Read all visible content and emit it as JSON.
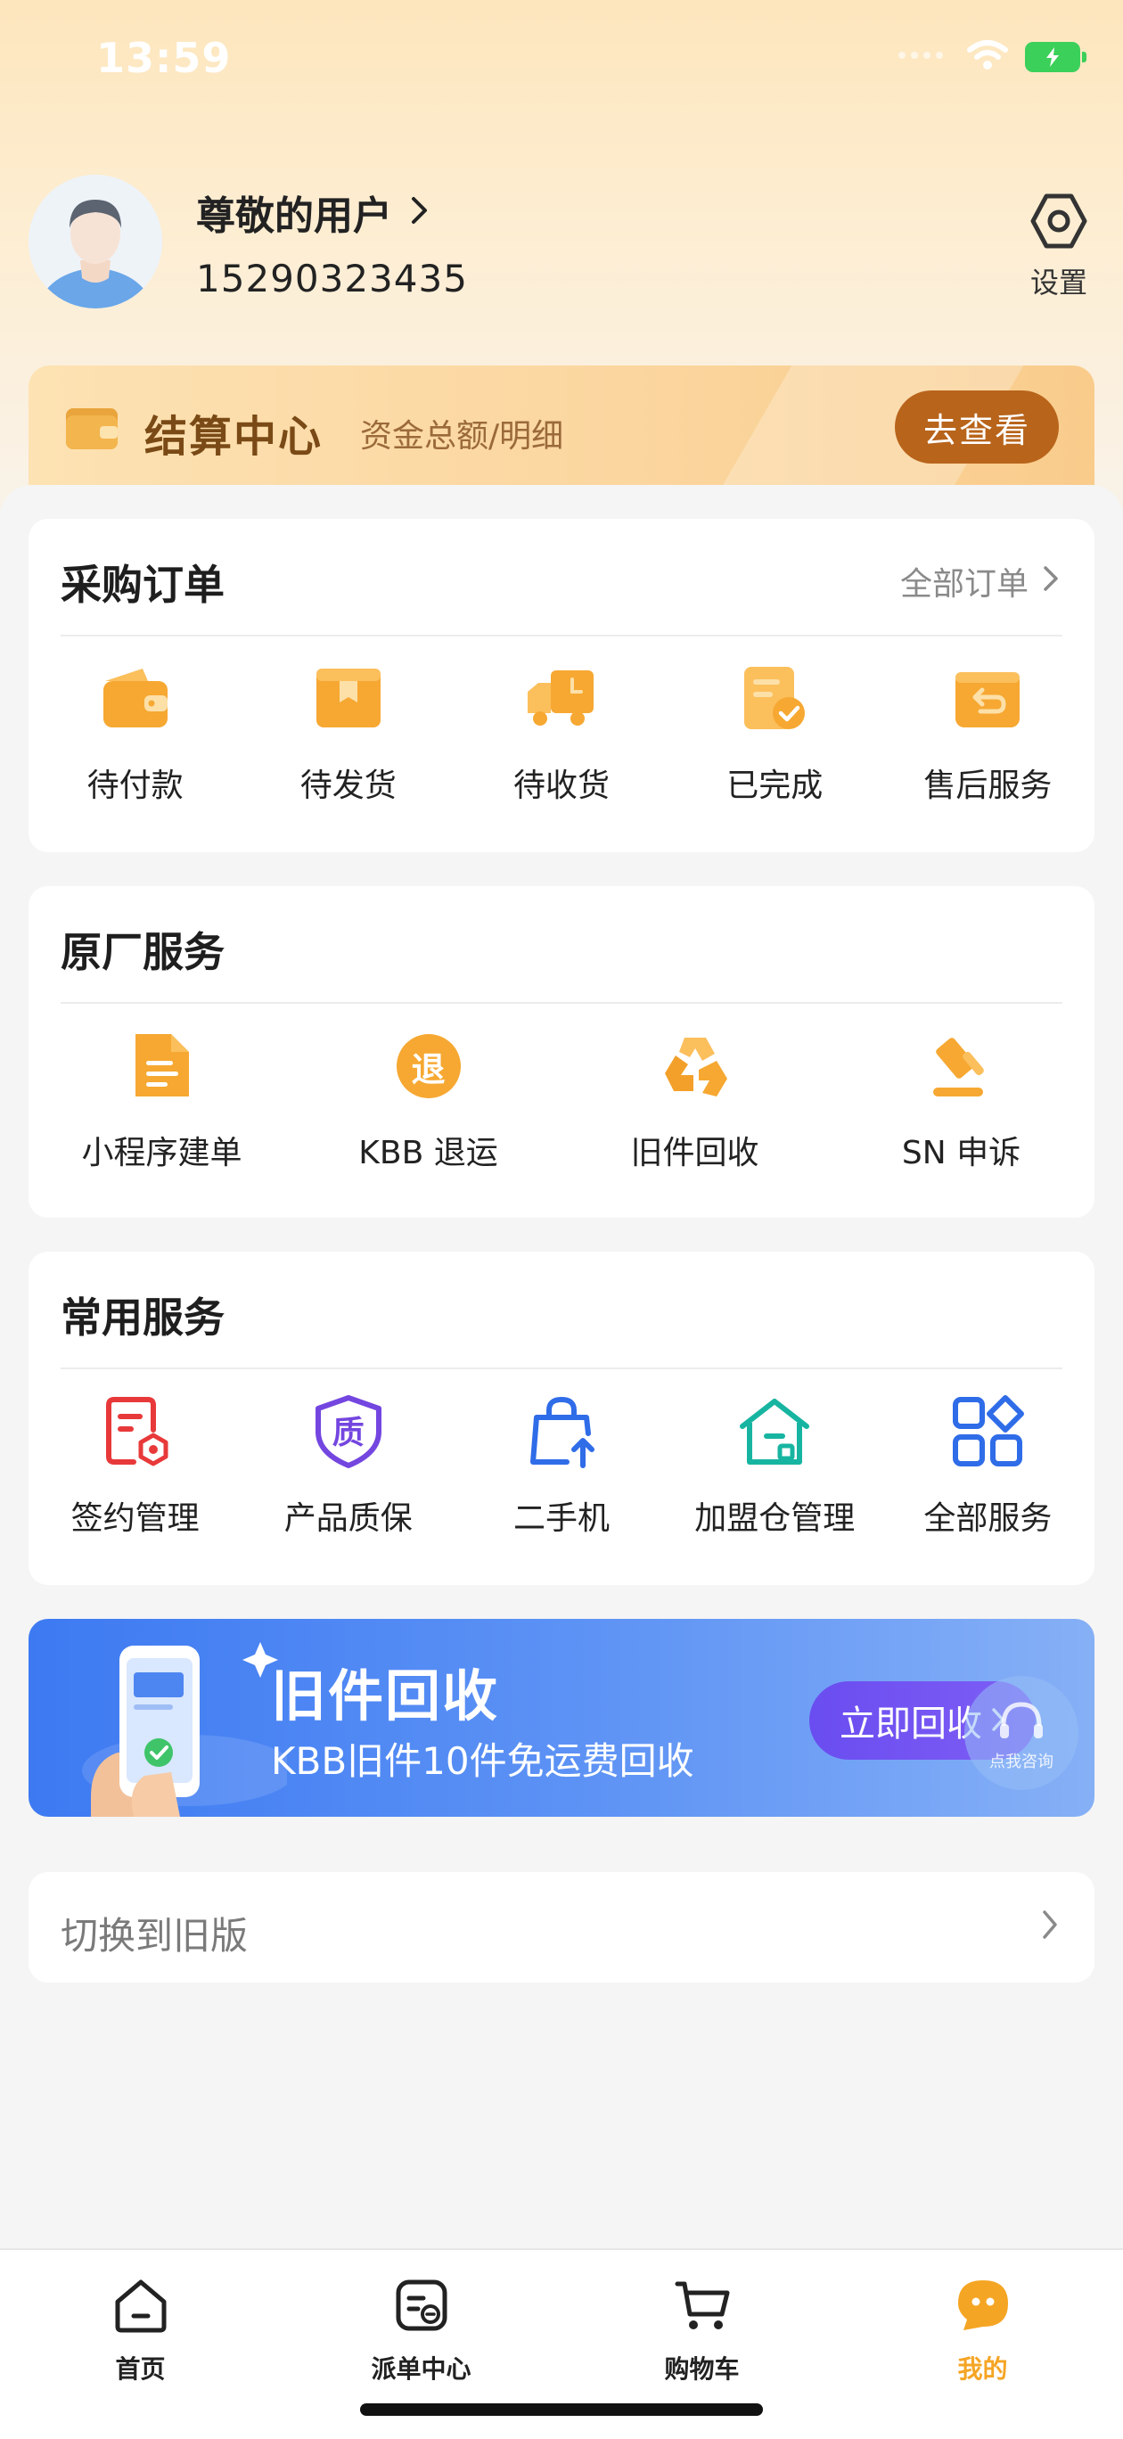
{
  "status": {
    "time": "13:59"
  },
  "profile": {
    "username": "尊敬的用户",
    "phone": "15290323435",
    "settings_label": "设置"
  },
  "settlement": {
    "title": "结算中心",
    "subtitle": "资金总额/明细",
    "button": "去查看"
  },
  "purchase_orders": {
    "title": "采购订单",
    "link": "全部订单",
    "items": [
      {
        "label": "待付款",
        "icon": "wallet-icon"
      },
      {
        "label": "待发货",
        "icon": "box-icon"
      },
      {
        "label": "待收货",
        "icon": "truck-icon"
      },
      {
        "label": "已完成",
        "icon": "completed-doc-icon"
      },
      {
        "label": "售后服务",
        "icon": "return-icon"
      }
    ]
  },
  "factory_services": {
    "title": "原厂服务",
    "items": [
      {
        "label": "小程序建单",
        "icon": "document-icon"
      },
      {
        "label": "KBB 退运",
        "icon": "return-badge-icon",
        "badge": "退"
      },
      {
        "label": "旧件回收",
        "icon": "recycle-icon"
      },
      {
        "label": "SN 申诉",
        "icon": "gavel-icon"
      }
    ]
  },
  "common_services": {
    "title": "常用服务",
    "items": [
      {
        "label": "签约管理",
        "icon": "contract-icon"
      },
      {
        "label": "产品质保",
        "icon": "quality-shield-icon",
        "badge": "质"
      },
      {
        "label": "二手机",
        "icon": "bag-upload-icon"
      },
      {
        "label": "加盟仓管理",
        "icon": "warehouse-icon"
      },
      {
        "label": "全部服务",
        "icon": "grid-apps-icon"
      }
    ]
  },
  "banner": {
    "title": "旧件回收",
    "subtitle": "KBB旧件10件免运费回收",
    "button": "立即回收",
    "consult_label": "点我咨询"
  },
  "switch_version": {
    "label": "切换到旧版"
  },
  "tabbar": {
    "items": [
      {
        "label": "首页",
        "icon": "home-icon",
        "active": false
      },
      {
        "label": "派单中心",
        "icon": "dispatch-icon",
        "active": false
      },
      {
        "label": "购物车",
        "icon": "cart-icon",
        "active": false
      },
      {
        "label": "我的",
        "icon": "profile-chat-icon",
        "active": true
      }
    ]
  },
  "colors": {
    "accent": "#f5a524",
    "settle_button": "#b8641b",
    "banner_blue": "#3d7af2"
  }
}
